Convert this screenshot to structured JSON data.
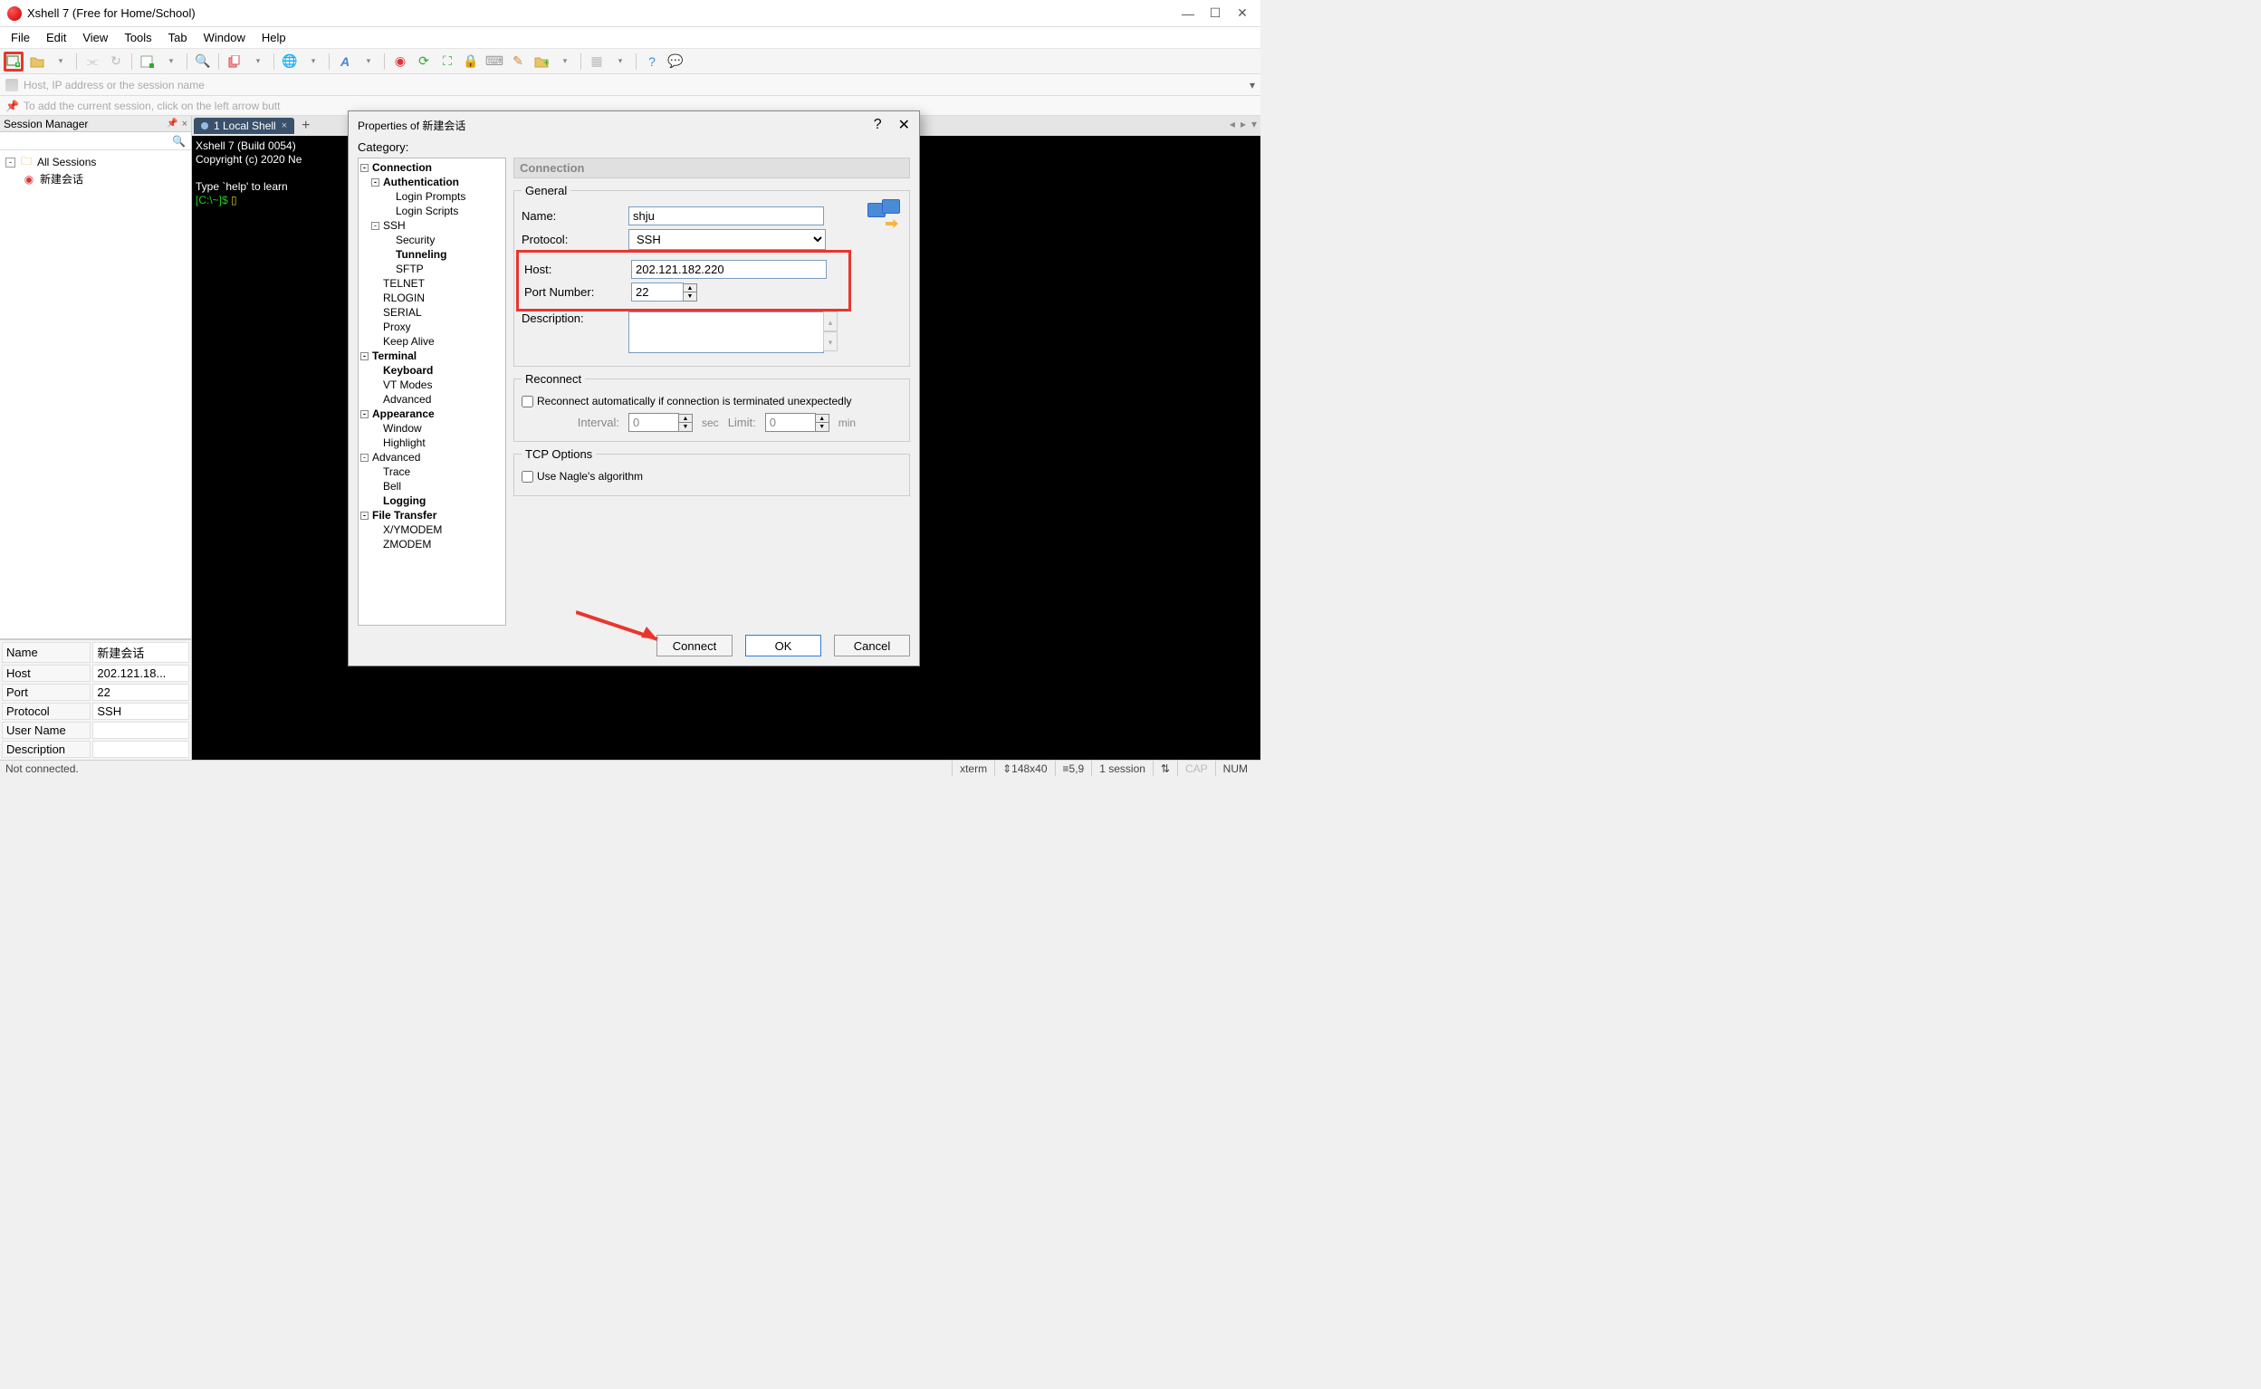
{
  "title": "Xshell 7 (Free for Home/School)",
  "menu": [
    "File",
    "Edit",
    "View",
    "Tools",
    "Tab",
    "Window",
    "Help"
  ],
  "addressbar": {
    "placeholder": "Host, IP address or the session name"
  },
  "hintbar": {
    "text": "To add the current session, click on the left arrow butt"
  },
  "session_manager": {
    "title": "Session Manager",
    "tree": {
      "root": "All Sessions",
      "child": "新建会话"
    },
    "props": [
      {
        "k": "Name",
        "v": "新建会话"
      },
      {
        "k": "Host",
        "v": "202.121.18..."
      },
      {
        "k": "Port",
        "v": "22"
      },
      {
        "k": "Protocol",
        "v": "SSH"
      },
      {
        "k": "User Name",
        "v": ""
      },
      {
        "k": "Description",
        "v": ""
      }
    ]
  },
  "tab": {
    "label": "1 Local Shell"
  },
  "terminal": {
    "line1": "Xshell 7 (Build 0054)",
    "line2": "Copyright (c) 2020 Ne",
    "line3": "Type `help' to learn",
    "prompt": "[C:\\~]$ "
  },
  "dialog": {
    "title": "Properties of 新建会话",
    "category_label": "Category:",
    "section_title": "Connection",
    "general": {
      "legend": "General",
      "name_label": "Name:",
      "name_value": "shju",
      "protocol_label": "Protocol:",
      "protocol_value": "SSH",
      "host_label": "Host:",
      "host_value": "202.121.182.220",
      "port_label": "Port Number:",
      "port_value": "22",
      "description_label": "Description:",
      "description_value": ""
    },
    "reconnect": {
      "legend": "Reconnect",
      "checkbox": "Reconnect automatically if connection is terminated unexpectedly",
      "interval_label": "Interval:",
      "interval_value": "0",
      "interval_unit": "sec",
      "limit_label": "Limit:",
      "limit_value": "0",
      "limit_unit": "min"
    },
    "tcp": {
      "legend": "TCP Options",
      "checkbox": "Use Nagle's algorithm"
    },
    "buttons": {
      "connect": "Connect",
      "ok": "OK",
      "cancel": "Cancel"
    },
    "tree": [
      {
        "t": "Connection",
        "d": 0,
        "b": 1,
        "e": "-"
      },
      {
        "t": "Authentication",
        "d": 1,
        "b": 1,
        "e": "-"
      },
      {
        "t": "Login Prompts",
        "d": 2,
        "b": 0,
        "e": ""
      },
      {
        "t": "Login Scripts",
        "d": 2,
        "b": 0,
        "e": ""
      },
      {
        "t": "SSH",
        "d": 1,
        "b": 0,
        "e": "-"
      },
      {
        "t": "Security",
        "d": 3,
        "b": 0,
        "e": ""
      },
      {
        "t": "Tunneling",
        "d": 3,
        "b": 1,
        "e": ""
      },
      {
        "t": "SFTP",
        "d": 3,
        "b": 0,
        "e": ""
      },
      {
        "t": "TELNET",
        "d": 1,
        "b": 0,
        "e": ""
      },
      {
        "t": "RLOGIN",
        "d": 1,
        "b": 0,
        "e": ""
      },
      {
        "t": "SERIAL",
        "d": 1,
        "b": 0,
        "e": ""
      },
      {
        "t": "Proxy",
        "d": 1,
        "b": 0,
        "e": ""
      },
      {
        "t": "Keep Alive",
        "d": 1,
        "b": 0,
        "e": ""
      },
      {
        "t": "Terminal",
        "d": 0,
        "b": 1,
        "e": "-"
      },
      {
        "t": "Keyboard",
        "d": 1,
        "b": 1,
        "e": ""
      },
      {
        "t": "VT Modes",
        "d": 1,
        "b": 0,
        "e": ""
      },
      {
        "t": "Advanced",
        "d": 1,
        "b": 0,
        "e": ""
      },
      {
        "t": "Appearance",
        "d": 0,
        "b": 1,
        "e": "-"
      },
      {
        "t": "Window",
        "d": 1,
        "b": 0,
        "e": ""
      },
      {
        "t": "Highlight",
        "d": 1,
        "b": 0,
        "e": ""
      },
      {
        "t": "Advanced",
        "d": 0,
        "b": 0,
        "e": "-"
      },
      {
        "t": "Trace",
        "d": 1,
        "b": 0,
        "e": ""
      },
      {
        "t": "Bell",
        "d": 1,
        "b": 0,
        "e": ""
      },
      {
        "t": "Logging",
        "d": 1,
        "b": 1,
        "e": ""
      },
      {
        "t": "File Transfer",
        "d": 0,
        "b": 1,
        "e": "-"
      },
      {
        "t": "X/YMODEM",
        "d": 1,
        "b": 0,
        "e": ""
      },
      {
        "t": "ZMODEM",
        "d": 1,
        "b": 0,
        "e": ""
      }
    ]
  },
  "statusbar": {
    "left": "Not connected.",
    "term": "xterm",
    "size": "148x40",
    "pos": "5,9",
    "sessions": "1 session",
    "caps": "CAP",
    "num": "NUM"
  }
}
